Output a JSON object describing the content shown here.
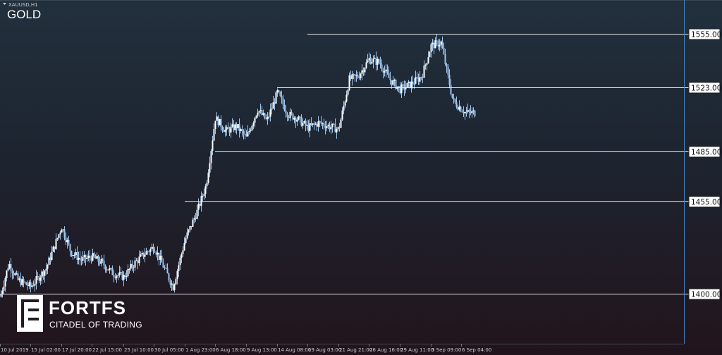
{
  "window": {
    "symbol_tab": "XAUUSD,H1",
    "title": "GOLD"
  },
  "logo": {
    "name": "FORTFS",
    "tagline": "CITADEL OF TRADING"
  },
  "colors": {
    "candle": "#9fc4ea",
    "level_line": "#e6e6e6",
    "right_axis": "#4a86c2",
    "label_bg": "#ffffff",
    "label_text": "#111111"
  },
  "chart_data": {
    "type": "line",
    "title": "GOLD",
    "symbol": "XAUUSD",
    "timeframe": "H1",
    "ylim": [
      1370,
      1572
    ],
    "xlabel": "",
    "ylabel": "",
    "grid": false,
    "time_labels": [
      "10 Jul 2019",
      "15 Jul 02:00",
      "17 Jul 20:00",
      "22 Jul 15:00",
      "25 Jul 10:00",
      "30 Jul 05:00",
      "1 Aug 23:00",
      "6 Aug 18:00",
      "9 Aug 13:00",
      "14 Aug 08:00",
      "19 Aug 03:00",
      "21 Aug 21:00",
      "26 Aug 16:00",
      "29 Aug 11:00",
      "3 Sep 09:00",
      "6 Sep 04:00"
    ],
    "levels": [
      {
        "value": 1555.0,
        "label": "1555.00",
        "x_start_label": "19 Aug 03:00"
      },
      {
        "value": 1523.0,
        "label": "1523.00",
        "x_start_label": "14 Aug 08:00"
      },
      {
        "value": 1485.0,
        "label": "1485.00",
        "x_start_label": "6 Aug 18:00"
      },
      {
        "value": 1455.0,
        "label": "1455.00",
        "x_start_label": "1 Aug 23:00"
      },
      {
        "value": 1400.0,
        "label": "1400.00",
        "x_start_label": "10 Jul 2019"
      }
    ],
    "series": [
      {
        "x": [
          "10 Jul 2019",
          "11 Jul",
          "12 Jul",
          "15 Jul 02:00",
          "16 Jul",
          "17 Jul 20:00",
          "18 Jul",
          "19 Jul",
          "22 Jul 15:00",
          "23 Jul",
          "24 Jul",
          "25 Jul 10:00",
          "26 Jul",
          "29 Jul",
          "30 Jul 05:00",
          "31 Jul",
          "1 Aug 23:00",
          "2 Aug",
          "5 Aug",
          "6 Aug 18:00",
          "7 Aug",
          "8 Aug",
          "9 Aug 13:00",
          "12 Aug",
          "13 Aug",
          "14 Aug 08:00",
          "15 Aug",
          "16 Aug",
          "19 Aug 03:00",
          "20 Aug",
          "21 Aug 21:00",
          "22 Aug",
          "23 Aug",
          "26 Aug 16:00",
          "27 Aug",
          "28 Aug",
          "29 Aug 11:00",
          "30 Aug",
          "2 Sep",
          "3 Sep 09:00",
          "4 Sep",
          "5 Sep",
          "6 Sep 04:00"
        ],
        "values": [
          1398,
          1418,
          1408,
          1404,
          1415,
          1440,
          1425,
          1420,
          1422,
          1418,
          1412,
          1410,
          1418,
          1424,
          1428,
          1404,
          1432,
          1450,
          1465,
          1505,
          1497,
          1500,
          1493,
          1510,
          1503,
          1520,
          1507,
          1505,
          1499,
          1502,
          1498,
          1528,
          1530,
          1540,
          1538,
          1528,
          1522,
          1525,
          1530,
          1548,
          1550,
          1515,
          1508
        ]
      }
    ]
  }
}
